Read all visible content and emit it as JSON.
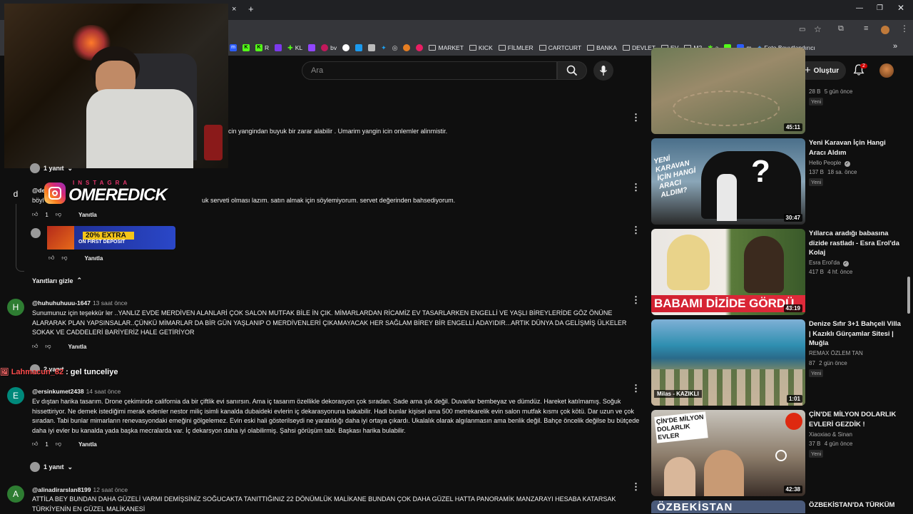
{
  "browser": {
    "close_tab_glyph": "×",
    "new_tab_glyph": "+",
    "bookmarks": [
      {
        "label": "",
        "color": "#2b5cff",
        "glyph": "m"
      },
      {
        "label": "",
        "color": "#53fc18",
        "glyph": "K"
      },
      {
        "label": "R",
        "color": "#53fc18",
        "glyph": "K"
      },
      {
        "label": "",
        "color": "#7c3aed",
        "glyph": "●"
      },
      {
        "label": "KL",
        "color": "#53fc18",
        "glyph": "✚"
      },
      {
        "label": "",
        "color": "#9146ff",
        "glyph": "▣"
      },
      {
        "label": "bv",
        "color": "#c2185b",
        "glyph": "●"
      },
      {
        "label": "",
        "color": "#ffffff",
        "glyph": "●"
      },
      {
        "label": "",
        "color": "#1b9aee",
        "glyph": "▲"
      },
      {
        "label": "",
        "color": "#bbbbbb",
        "glyph": "▣"
      },
      {
        "label": "",
        "color": "#1da1f2",
        "glyph": "✦"
      },
      {
        "label": "",
        "color": "#dddddd",
        "glyph": "◎"
      },
      {
        "label": "",
        "color": "#e67e22",
        "glyph": "●"
      },
      {
        "label": "",
        "color": "#e91e63",
        "glyph": "●"
      }
    ],
    "folders": [
      "MARKET",
      "KICK",
      "FİLMLER",
      "CARTCURT",
      "BANKA",
      "DEVLET",
      "EV",
      "M2"
    ],
    "extra_bookmarks": [
      "a",
      "",
      "m",
      "Foto Boyutlandırıcı"
    ],
    "more": "»"
  },
  "header": {
    "search_placeholder": "Ara",
    "create_label": "Oluştur",
    "notification_count": "2"
  },
  "overlay": {
    "instagram_label": "INSTAGRA",
    "instagram_handle": "OMEREDICK",
    "promo_line1": "20% EXTRA",
    "promo_line2": "ON FIRST DEPOSIT",
    "chat_user": "Lahmacun_82",
    "chat_message": ": gel tunceliye"
  },
  "comments": {
    "c0": {
      "text": "cin yangindan buyuk bir zarar alabilir . Umarim yangin icin onlemler alinmistir.",
      "replies_label": "1 yanıt"
    },
    "c1": {
      "avatar_letter": "d",
      "avatar_color": "#2e7d32",
      "handle": "@de",
      "text_start": "böyl",
      "text": "uk serveti olması lazım. satın almak için söylemiyorum. servet değerinden bahsediyorum.",
      "likes": "1",
      "reply_label": "Yanıtla"
    },
    "c1_reply": {
      "reply_label": "Yanıtla"
    },
    "hide_replies": "Yanıtları gizle",
    "c2": {
      "avatar_letter": "H",
      "avatar_color": "#2e7d32",
      "handle": "@huhuhuhuuu-1647",
      "time": "13 saat önce",
      "text": "Sunumunuz için teşekkür ler ..YANLIZ EVDE MERDİVEN ALANLARİ ÇOK SALON MUTFAK BİLE İN ÇIK. MİMARLARDAN RİCAMİZ EV TASARLARKEN ENGELLİ VE YAŞLI BİREYLERİDE GÖZ ÖNÜNE ALARARAK PLAN YAPSINSALAR..ÇÜNKÜ MİMARLAR DA BİR GÜN YAŞLANIP O MERDİVENLERİ ÇIKAMAYACAK HER SAĞLAM BİREY BİR ENGELLİ ADAYIDIR...ARTIK DÜNYA DA GELİŞMİŞ ÜLKELER SOKAK VE CADDELERİ BARİYERİZ HALE GETİRİYOR",
      "reply_label": "Yanıtla",
      "replies_label": "2 yanıt"
    },
    "c3": {
      "avatar_letter": "E",
      "avatar_color": "#00897b",
      "handle": "@ersinkumet2438",
      "time": "14 saat önce",
      "text": "Ev dıştan harika tasarım. Drone çekiminde california da bir çiftlik evi sanırsın. Ama iç tasarım özellikle dekorasyon çok sıradan. Sade ama şık değil. Duvarlar bembeyaz ve dümdüz. Hareket katılmamış. Soğuk hissettiriyor. Ne demek istediğimi merak edenler nestor miliç isimli kanalda dubaideki evlerin iç dekarasyonuna bakabilir. Hadi bunlar kişisel ama 500 metrekarelik evin salon mutfak kısmı çok kötü. Dar uzun ve çok sıradan. Tabi bunlar mimarların renevasyondaki emeğini gölgelemez. Evin eski hali gösterilseydi ne yaratıldığı daha iyi ortaya çıkardı. Ukalalık olarak algılanmasın ama benlik değil. Bahçe öncelik değilse bu bütçede daha iyi evler bu kanalda yada başka mecralarda var. İç dekarsyon daha iyi olabilirmiş. Şahsi görüşüm tabi. Başkası harika bulabilir.",
      "likes": "1",
      "reply_label": "Yanıtla",
      "replies_label": "1 yanıt"
    },
    "c4": {
      "avatar_letter": "A",
      "avatar_color": "#2e7d32",
      "handle": "@alinadirarslan8199",
      "time": "12 saat önce",
      "text": "ATTİLA BEY BUNDAN DAHA GÜZELİ VARMI DEMİŞSİNİZ SOĞUCAKTA TANITTIĞINIZ 22 DÖNÜMLÜK MALİKANE BUNDAN ÇOK DAHA GÜZEL HATTA PANORAMİK MANZARAYI HESABA KATARSAK TÜRKİYENİN EN GÜZEL MALİKANESİ"
    }
  },
  "sidebar": {
    "v0": {
      "duration": "45:11",
      "views": "28 B",
      "age": "5 gün önce",
      "new": "Yeni"
    },
    "v1": {
      "title": "Yeni Karavan İçin Hangi Aracı Aldım",
      "channel": "Hello People",
      "views": "137 B",
      "age": "18 sa. önce",
      "new": "Yeni",
      "duration": "30:47",
      "thumb_text": "YENİ KARAVAN İÇİN HANGİ ARACI ALDIM?"
    },
    "v2": {
      "title": "Yıllarca aradığı babasına dizide rastladı  - Esra Erol'da Kolaj",
      "channel": "Esra Erol'da",
      "views": "417 B",
      "age": "4 hf. önce",
      "duration": "43:19",
      "thumb_text": "BABAMI DİZİDE GÖRDÜ"
    },
    "v3": {
      "title": "Denize Sıfır 3+1 Bahçeli Villa | Kazıklı Gürçamlar Sitesi | Muğla",
      "channel": "REMAX ÖZLEM TAN",
      "views": "87",
      "age": "2 gün önce",
      "new": "Yeni",
      "duration": "1:01",
      "thumb_text": "Milas - KAZIKLI"
    },
    "v4": {
      "title": "ÇİN'DE MİLYON DOLARLIK EVLERİ GEZDİK !",
      "channel": "Xiaoxiao & Sinan",
      "views": "37 B",
      "age": "4 gün önce",
      "new": "Yeni",
      "duration": "42:38",
      "thumb_text": "ÇİN'DE MİLYON DOLARLIK EVLER"
    },
    "v5": {
      "title": "ÖZBEKİSTAN'DA TÜRKÜM",
      "thumb_text": "ÖZBEKİSTAN"
    }
  }
}
